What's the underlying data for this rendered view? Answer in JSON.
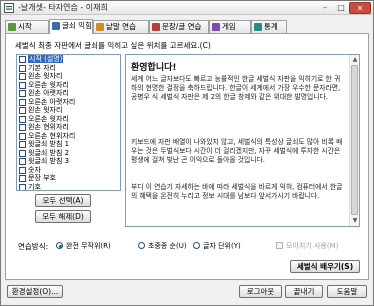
{
  "window": {
    "title": "-날개셋- 타자연습 - 이재희",
    "min_label": "–",
    "max_label": "□",
    "close_label": "✕"
  },
  "tabs": [
    {
      "label": "시작",
      "icon": "home-icon",
      "color": "#5a9a3a"
    },
    {
      "label": "글쇠 익힘",
      "icon": "keyboard-icon",
      "color": "#3a6ab0"
    },
    {
      "label": "낱말 연습",
      "icon": "word-icon",
      "color": "#d08a2a"
    },
    {
      "label": "문장/글 연습",
      "icon": "sentence-icon",
      "color": "#b04040"
    },
    {
      "label": "게임",
      "icon": "game-icon",
      "color": "#7a4ab0"
    },
    {
      "label": "통계",
      "icon": "stats-icon",
      "color": "#2a8a8a"
    }
  ],
  "instruction": "세벌식 최종 자판에서 글쇠를 익히고 싶은 위치를 고르세요.(C)",
  "positions": [
    {
      "label": "시작 (설명)",
      "selected": true
    },
    {
      "label": "기본 자리"
    },
    {
      "label": "왼손 윗자리"
    },
    {
      "label": "오른손 윗자리"
    },
    {
      "label": "왼손 아랫자리"
    },
    {
      "label": "오른손 아랫자리"
    },
    {
      "label": "왼손 윗자리"
    },
    {
      "label": "오른손 윗자리"
    },
    {
      "label": "왼손 현위자리"
    },
    {
      "label": "오른손 현위자리"
    },
    {
      "label": "윗글쇠 받침 1"
    },
    {
      "label": "윗글쇠 받침 2"
    },
    {
      "label": "윗글쇠 받침 3"
    },
    {
      "label": "숫자"
    },
    {
      "label": "문장 부호"
    },
    {
      "label": "기호"
    }
  ],
  "buttons": {
    "select_all": "모두 선택(A)",
    "clear_all": "모두 해제(D)",
    "start": "세벌식 배우기(S)",
    "settings": "환경설정(O)...",
    "logout": "로그아웃",
    "exit": "끝내기",
    "help": "도움말"
  },
  "text_panel": {
    "title": "환영합니다!",
    "paragraphs": [
      "세계 어느 글자보다도 빠르고 능률적인 한글 세벌식 자판을 익히기로 한 귀하의 현명한 결정을 축하드립니다. 한글이 세계에서 가장 우수한 문자라면, 공병우 식 세벌식 자판은 제 2의 한글 창제와 같은 위대한 발명입니다.",
      "키보드에 자판 배열이 나와있지 않고, 세벌식의 특성상 글쇠도 많아 비록 배우는 것은 두벌식보다 시간이 더 걸리겠지만, 자꾸 세벌식에 투자한 시간은 평생에 걸쳐 빛난 곤 이익으로 돌아올 것입니다.",
      "부디 이 연습기 자세하는 바에 따라 세벌식을 바르게 익혀, 컴퓨터에서 한글의 혜택을 온전히 누리고 정보 시대를 남보다 앞서가시기 바랍니다."
    ]
  },
  "mode": {
    "label": "연습방식:",
    "options": [
      {
        "label": "완전 무작위(R)",
        "checked": true
      },
      {
        "label": "초중종 순(U)",
        "checked": false
      },
      {
        "label": "글자 단위(Y)",
        "checked": false
      }
    ],
    "hide_label": "모아치기 사용(M)"
  }
}
